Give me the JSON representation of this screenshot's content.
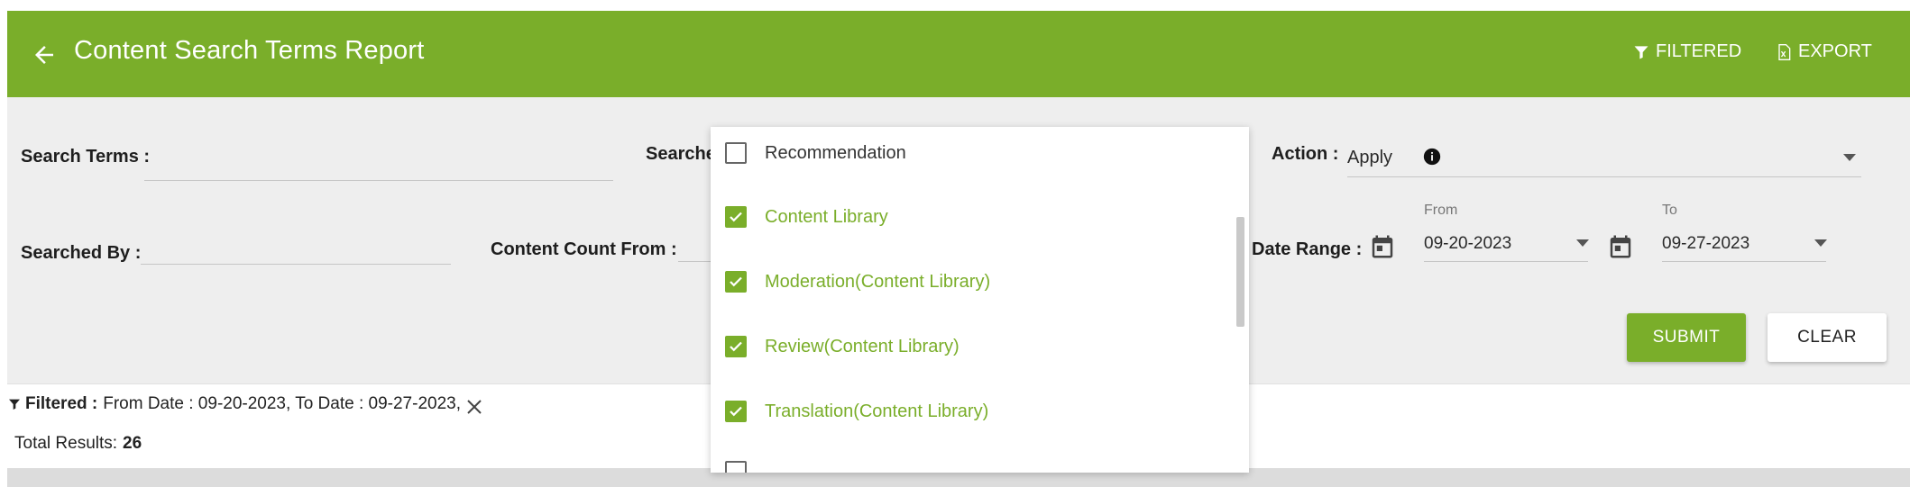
{
  "header": {
    "title": "Content Search Terms Report",
    "filtered_label": "FILTERED",
    "export_label": "EXPORT",
    "color": "#7aae2a"
  },
  "form": {
    "search_terms_label": "Search Terms :",
    "searched_in_label": "Searche",
    "action_label": "Action :",
    "action_value": "Apply",
    "searched_by_label": "Searched By :",
    "content_count_label": "Content Count From :",
    "date_range_label": "Date Range :",
    "from_label": "From",
    "from_value": "09-20-2023",
    "to_label": "To",
    "to_value": "09-27-2023",
    "submit_label": "SUBMIT",
    "clear_label": "CLEAR"
  },
  "filters": {
    "label": "Filtered :",
    "text": "From Date : 09-20-2023, To Date : 09-27-2023,"
  },
  "results": {
    "label": "Total Results:",
    "count": "26"
  },
  "dropdown": {
    "options": [
      {
        "label": "Recommendation",
        "checked": false
      },
      {
        "label": "Content Library",
        "checked": true
      },
      {
        "label": "Moderation(Content Library)",
        "checked": true
      },
      {
        "label": "Review(Content Library)",
        "checked": true
      },
      {
        "label": "Translation(Content Library)",
        "checked": true
      }
    ]
  }
}
